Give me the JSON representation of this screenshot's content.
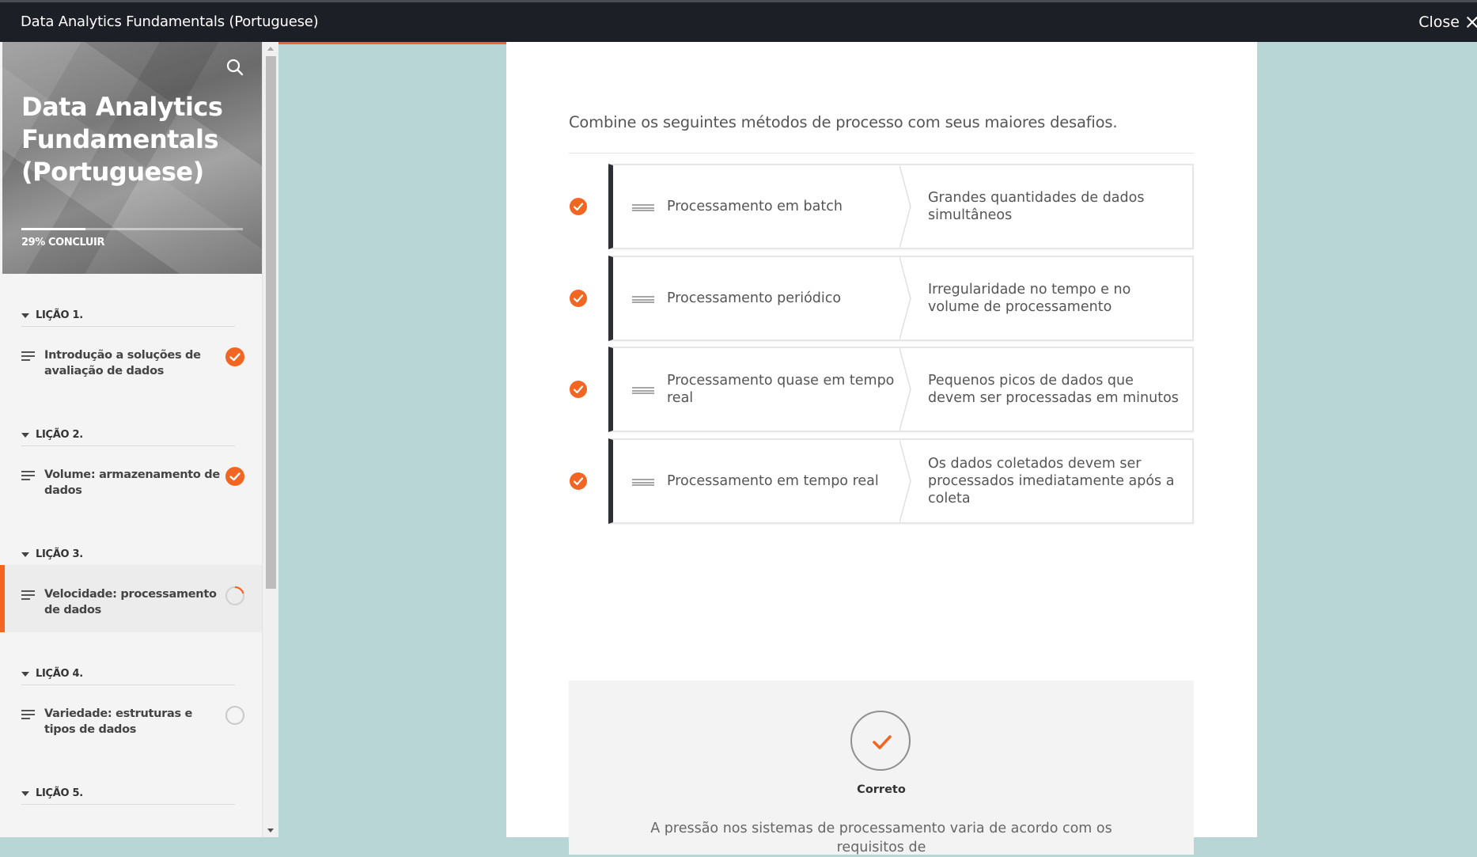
{
  "header": {
    "title": "Data Analytics Fundamentals (Portuguese)",
    "close_label": "Close"
  },
  "course": {
    "title": "Data Analytics Fundamentals (Portuguese)",
    "progress_percent": 29,
    "progress_label": "29% CONCLUIR"
  },
  "nav": {
    "lessons": [
      {
        "heading": "LIÇÃO 1.",
        "item": "Introdução a soluções de avaliação de dados",
        "status": "complete"
      },
      {
        "heading": "LIÇÃO 2.",
        "item": "Volume: armazenamento de dados",
        "status": "complete"
      },
      {
        "heading": "LIÇÃO 3.",
        "item": "Velocidade: processamento de dados",
        "status": "in-progress"
      },
      {
        "heading": "LIÇÃO 4.",
        "item": "Variedade: estruturas e tipos de dados",
        "status": "not-started"
      },
      {
        "heading": "LIÇÃO 5.",
        "item": "",
        "status": ""
      }
    ]
  },
  "quiz": {
    "prompt": "Combine os seguintes métodos de processo com seus maiores desafios.",
    "pairs": [
      {
        "left": "Processamento em batch",
        "right": "Grandes quantidades de dados simultâneos"
      },
      {
        "left": "Processamento periódico",
        "right": "Irregularidade no tempo e no volume de processamento"
      },
      {
        "left": "Processamento quase em tempo real",
        "right": "Pequenos picos de dados que devem ser processadas em minutos"
      },
      {
        "left": "Processamento em tempo real",
        "right": "Os dados coletados devem ser processados imediatamente após a coleta"
      }
    ],
    "result_label": "Correto",
    "explanation": "A pressão nos sistemas de processamento varia de acordo com os requisitos de"
  },
  "colors": {
    "accent": "#f26522",
    "topbar": "#1c1f26",
    "background": "#b9d6d6"
  }
}
